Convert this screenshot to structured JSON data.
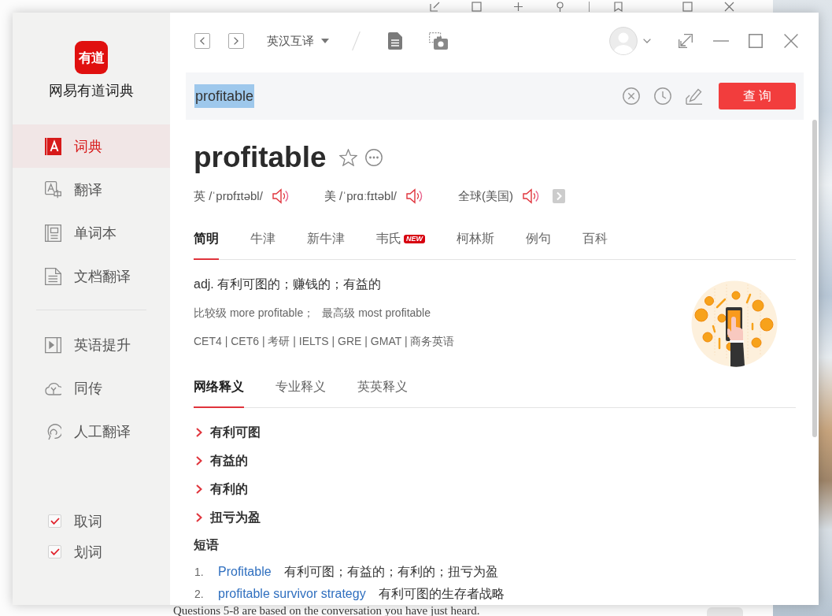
{
  "background_page": {
    "text": "Questions 5-8 are based on the conversation you have just heard."
  },
  "sidebar": {
    "logo_text": "有道",
    "app_name": "网易有道词典",
    "primary_items": [
      {
        "label": "词典",
        "selected": true
      },
      {
        "label": "翻译",
        "selected": false
      },
      {
        "label": "单词本",
        "selected": false
      },
      {
        "label": "文档翻译",
        "selected": false
      }
    ],
    "service_items": [
      {
        "label": "英语提升",
        "selected": false
      },
      {
        "label": "同传",
        "selected": false
      },
      {
        "label": "人工翻译",
        "selected": false
      }
    ],
    "options": [
      {
        "label": "取词",
        "checked": true
      },
      {
        "label": "划词",
        "checked": true
      }
    ]
  },
  "toolbar": {
    "language": "英汉互译"
  },
  "search": {
    "value": "profitable",
    "text_selected": true,
    "button": "查 询"
  },
  "entry": {
    "headword": "profitable",
    "pronunciations": [
      "英 /ˈprɒfɪtəbl/",
      "美 /ˈprɑːfɪtəbl/",
      "全球(美国)"
    ],
    "dictionary_tabs": [
      {
        "label": "简明",
        "selected": true
      },
      {
        "label": "牛津",
        "selected": false
      },
      {
        "label": "新牛津",
        "selected": false
      },
      {
        "label": "韦氏",
        "badge": "NEW",
        "selected": false
      },
      {
        "label": "柯林斯",
        "selected": false
      },
      {
        "label": "例句",
        "selected": false
      },
      {
        "label": "百科",
        "selected": false
      }
    ],
    "definition": "adj. 有利可图的；赚钱的；有益的",
    "word_forms": [
      "比较级 more profitable；",
      "最高级 most profitable"
    ],
    "exams": "CET4 | CET6 | 考研 | IELTS | GRE | GMAT | 商务英语",
    "meaning_tabs": [
      {
        "label": "网络释义",
        "selected": true
      },
      {
        "label": "专业释义",
        "selected": false
      },
      {
        "label": "英英释义",
        "selected": false
      }
    ],
    "web_meanings": [
      "有利可图",
      "有益的",
      "有利的",
      "扭亏为盈"
    ],
    "phrases_title": "短语",
    "phrases": [
      {
        "number": "1.",
        "phrase": "Profitable",
        "meaning": "有利可图；有益的；有利的；扭亏为盈"
      },
      {
        "number": "2.",
        "phrase": "profitable survivor strategy",
        "meaning": "有利可图的生存者战略"
      }
    ]
  }
}
